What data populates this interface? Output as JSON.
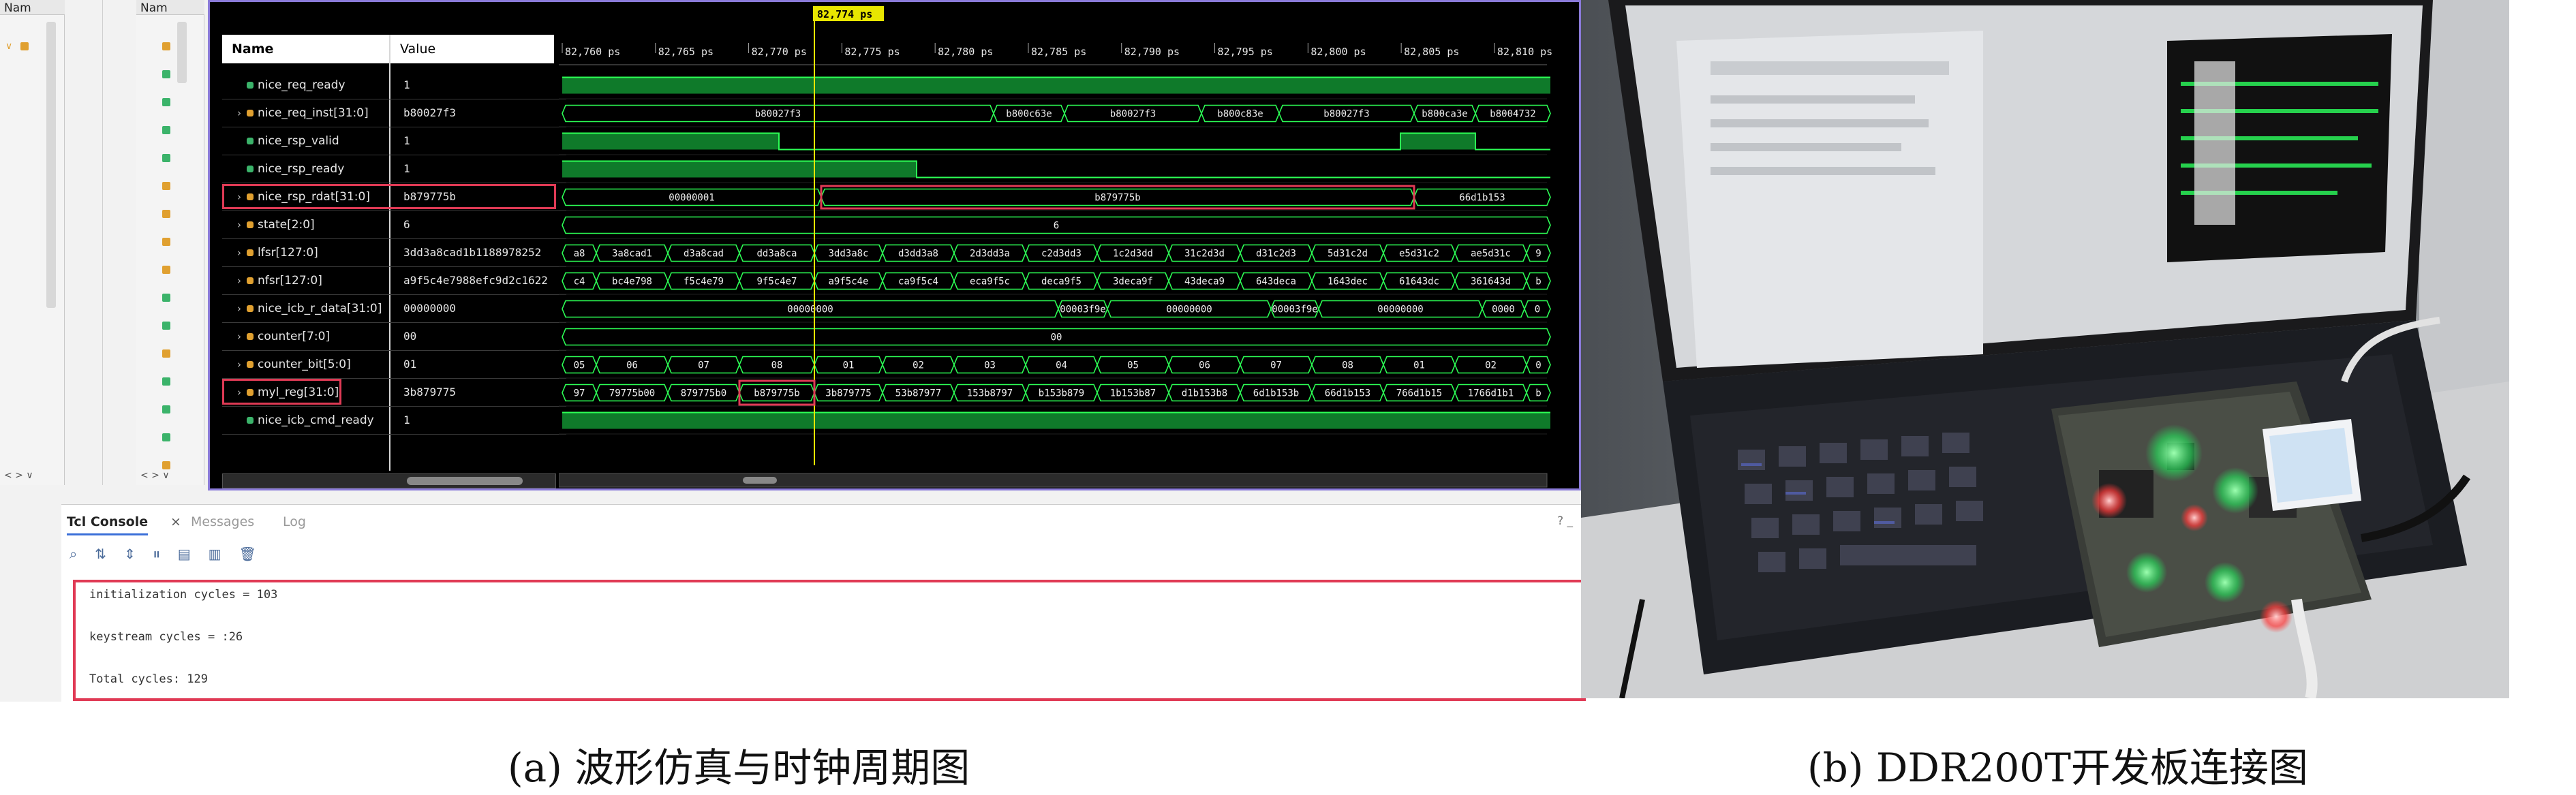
{
  "left_panel": {
    "title_a": "Nam",
    "title_b": "Nam",
    "scroll_a": "< > ∨",
    "scroll_b": "< > ∨"
  },
  "wave": {
    "name_header": "Name",
    "value_header": "Value",
    "cursor_label": "82,774 ps",
    "time_ticks": [
      "82,760 ps",
      "82,765 ps",
      "82,770 ps",
      "82,775 ps",
      "82,780 ps",
      "82,785 ps",
      "82,790 ps",
      "82,795 ps",
      "82,800 ps",
      "82,805 ps",
      "82,810 ps"
    ],
    "signals": [
      {
        "name": "nice_req_ready",
        "value": "1",
        "expandable": false,
        "type": "bit",
        "icon_color": "#3bb36a"
      },
      {
        "name": "nice_req_inst[31:0]",
        "value": "b80027f3",
        "expandable": true,
        "type": "bus",
        "icon_color": "#e0a030"
      },
      {
        "name": "nice_rsp_valid",
        "value": "1",
        "expandable": false,
        "type": "bit",
        "icon_color": "#3bb36a"
      },
      {
        "name": "nice_rsp_ready",
        "value": "1",
        "expandable": false,
        "type": "bit",
        "icon_color": "#3bb36a"
      },
      {
        "name": "nice_rsp_rdat[31:0]",
        "value": "b879775b",
        "expandable": true,
        "type": "bus",
        "icon_color": "#e0a030"
      },
      {
        "name": "state[2:0]",
        "value": "6",
        "expandable": true,
        "type": "bus",
        "icon_color": "#e0a030"
      },
      {
        "name": "lfsr[127:0]",
        "value": "3dd3a8cad1b1188978252",
        "expandable": true,
        "type": "bus",
        "icon_color": "#e0a030"
      },
      {
        "name": "nfsr[127:0]",
        "value": "a9f5c4e7988efc9d2c1622",
        "expandable": true,
        "type": "bus",
        "icon_color": "#e0a030"
      },
      {
        "name": "nice_icb_r_data[31:0]",
        "value": "00000000",
        "expandable": true,
        "type": "bus",
        "icon_color": "#e0a030"
      },
      {
        "name": "counter[7:0]",
        "value": "00",
        "expandable": true,
        "type": "bus",
        "icon_color": "#e0a030"
      },
      {
        "name": "counter_bit[5:0]",
        "value": "01",
        "expandable": true,
        "type": "bus",
        "icon_color": "#e0a030"
      },
      {
        "name": "myl_reg[31:0]",
        "value": "3b879775",
        "expandable": true,
        "type": "bus",
        "icon_color": "#e0a030"
      },
      {
        "name": "nice_icb_cmd_ready",
        "value": "1",
        "expandable": false,
        "type": "bit",
        "icon_color": "#3bb36a"
      }
    ],
    "traces": [
      {
        "kind": "bit",
        "segs": [
          [
            0,
            1450,
            1
          ]
        ]
      },
      {
        "kind": "bus",
        "segs": [
          [
            0,
            633,
            "b80027f3"
          ],
          [
            633,
            737,
            "b800c63e"
          ],
          [
            737,
            938,
            "b80027f3"
          ],
          [
            938,
            1052,
            "b800c83e"
          ],
          [
            1052,
            1250,
            "b80027f3"
          ],
          [
            1250,
            1340,
            "b800ca3e"
          ],
          [
            1340,
            1450,
            "b8004732"
          ]
        ]
      },
      {
        "kind": "bit",
        "segs": [
          [
            0,
            318,
            1
          ],
          [
            318,
            1230,
            0
          ],
          [
            1230,
            1340,
            1
          ],
          [
            1340,
            1450,
            0
          ]
        ]
      },
      {
        "kind": "bit",
        "segs": [
          [
            0,
            520,
            1
          ],
          [
            520,
            1450,
            0
          ]
        ]
      },
      {
        "kind": "bus",
        "segs": [
          [
            0,
            380,
            "00000001"
          ],
          [
            380,
            1250,
            "b879775b"
          ],
          [
            1250,
            1450,
            "66d1b153"
          ]
        ]
      },
      {
        "kind": "bus",
        "segs": [
          [
            0,
            1450,
            "6"
          ]
        ]
      },
      {
        "kind": "bus",
        "segs": [
          [
            0,
            50,
            "a8"
          ],
          [
            50,
            155,
            "3a8cad1"
          ],
          [
            155,
            260,
            "d3a8cad"
          ],
          [
            260,
            370,
            "dd3a8ca"
          ],
          [
            370,
            470,
            "3dd3a8c"
          ],
          [
            470,
            575,
            "d3dd3a8"
          ],
          [
            575,
            680,
            "2d3dd3a"
          ],
          [
            680,
            785,
            "c2d3dd3"
          ],
          [
            785,
            890,
            "1c2d3dd"
          ],
          [
            890,
            995,
            "31c2d3d"
          ],
          [
            995,
            1100,
            "d31c2d3"
          ],
          [
            1100,
            1205,
            "5d31c2d"
          ],
          [
            1205,
            1310,
            "e5d31c2"
          ],
          [
            1310,
            1415,
            "ae5d31c"
          ],
          [
            1415,
            1450,
            "9"
          ]
        ]
      },
      {
        "kind": "bus",
        "segs": [
          [
            0,
            50,
            "c4"
          ],
          [
            50,
            155,
            "bc4e798"
          ],
          [
            155,
            260,
            "f5c4e79"
          ],
          [
            260,
            370,
            "9f5c4e7"
          ],
          [
            370,
            470,
            "a9f5c4e"
          ],
          [
            470,
            575,
            "ca9f5c4"
          ],
          [
            575,
            680,
            "eca9f5c"
          ],
          [
            680,
            785,
            "deca9f5"
          ],
          [
            785,
            890,
            "3deca9f"
          ],
          [
            890,
            995,
            "43deca9"
          ],
          [
            995,
            1100,
            "643deca"
          ],
          [
            1100,
            1205,
            "1643dec"
          ],
          [
            1205,
            1310,
            "61643dc"
          ],
          [
            1310,
            1415,
            "361643d"
          ],
          [
            1415,
            1450,
            "b"
          ]
        ]
      },
      {
        "kind": "bus",
        "segs": [
          [
            0,
            728,
            "00000000"
          ],
          [
            728,
            800,
            "00003f9e"
          ],
          [
            800,
            1040,
            "00000000"
          ],
          [
            1040,
            1110,
            "00003f9e"
          ],
          [
            1110,
            1350,
            "00000000"
          ],
          [
            1350,
            1412,
            "0000"
          ],
          [
            1412,
            1450,
            "0"
          ]
        ]
      },
      {
        "kind": "bus",
        "segs": [
          [
            0,
            1450,
            "00"
          ]
        ]
      },
      {
        "kind": "bus",
        "segs": [
          [
            0,
            50,
            "05"
          ],
          [
            50,
            155,
            "06"
          ],
          [
            155,
            260,
            "07"
          ],
          [
            260,
            370,
            "08"
          ],
          [
            370,
            470,
            "01"
          ],
          [
            470,
            575,
            "02"
          ],
          [
            575,
            680,
            "03"
          ],
          [
            680,
            785,
            "04"
          ],
          [
            785,
            890,
            "05"
          ],
          [
            890,
            995,
            "06"
          ],
          [
            995,
            1100,
            "07"
          ],
          [
            1100,
            1205,
            "08"
          ],
          [
            1205,
            1310,
            "01"
          ],
          [
            1310,
            1415,
            "02"
          ],
          [
            1415,
            1450,
            "0"
          ]
        ]
      },
      {
        "kind": "bus",
        "segs": [
          [
            0,
            50,
            "97"
          ],
          [
            50,
            155,
            "79775b00"
          ],
          [
            155,
            260,
            "879775b0"
          ],
          [
            260,
            370,
            "b879775b"
          ],
          [
            370,
            470,
            "3b879775"
          ],
          [
            470,
            575,
            "53b87977"
          ],
          [
            575,
            680,
            "153b8797"
          ],
          [
            680,
            785,
            "b153b879"
          ],
          [
            785,
            890,
            "1b153b87"
          ],
          [
            890,
            995,
            "d1b153b8"
          ],
          [
            995,
            1100,
            "6d1b153b"
          ],
          [
            1100,
            1205,
            "66d1b153"
          ],
          [
            1205,
            1310,
            "766d1b15"
          ],
          [
            1310,
            1415,
            "1766d1b1"
          ],
          [
            1415,
            1450,
            "b"
          ]
        ]
      },
      {
        "kind": "bit",
        "segs": [
          [
            0,
            1450,
            1
          ]
        ]
      }
    ]
  },
  "console": {
    "tabs": [
      "Tcl Console",
      "Messages",
      "Log"
    ],
    "tab_close": "×",
    "window_ctrl": "? _",
    "tools": [
      "⌕",
      "⇅",
      "⇕",
      "⏸",
      "▤",
      "▥",
      "🗑"
    ],
    "lines": [
      "initialization cycles = 103",
      "keystream cycles = :26",
      "Total cycles: 129"
    ]
  },
  "captions": {
    "a": "(a) 波形仿真与时钟周期图",
    "b": "(b) DDR200T开发板连接图"
  }
}
